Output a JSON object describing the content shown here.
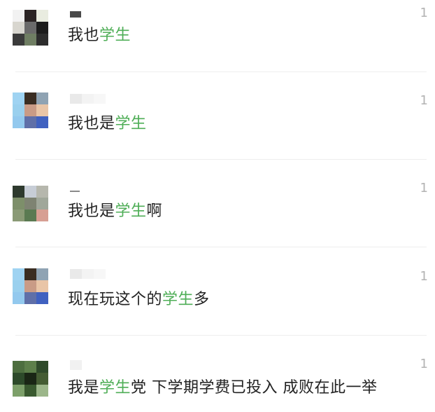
{
  "comments": [
    {
      "avatar_colors": [
        "#f2f2f2",
        "#2b2424",
        "#e9ece0",
        "#d8d6cf",
        "#6a6a6a",
        "#1c1c1c",
        "#3b3b3b",
        "#6f7e63",
        "#2d2d2d"
      ],
      "text_before": "我也",
      "keyword": "学生",
      "text_after": "",
      "likes": "1"
    },
    {
      "avatar_colors": [
        "#9fd3f2",
        "#3a2d22",
        "#8fa3b3",
        "#9ad0ee",
        "#c99b86",
        "#e9c5a7",
        "#93c9ee",
        "#5f6fa8",
        "#4061c0"
      ],
      "text_before": "我也是",
      "keyword": "学生",
      "text_after": "",
      "likes": "1"
    },
    {
      "avatar_colors": [
        "#2e3a2e",
        "#c7cdd6",
        "#b6b7ad",
        "#7d8f6a",
        "#7e8372",
        "#a0a79a",
        "#8a9a76",
        "#5a7a52",
        "#d79f93"
      ],
      "text_before": "我也是",
      "keyword": "学生",
      "text_after": "啊",
      "likes": "1"
    },
    {
      "avatar_colors": [
        "#9fd3f2",
        "#3a2d22",
        "#8fa3b3",
        "#9ad0ee",
        "#c99b86",
        "#e9c5a7",
        "#93c9ee",
        "#5f6fa8",
        "#4061c0"
      ],
      "text_before": "现在玩这个的",
      "keyword": "学生",
      "text_after": "多",
      "likes": "1"
    },
    {
      "avatar_colors": [
        "#4d6e3f",
        "#5d7f4a",
        "#2f4a2a",
        "#2d4a2a",
        "#1a2615",
        "#445c33",
        "#7da06a",
        "#3a5a30",
        "#9cb68a"
      ],
      "text_before": "我是",
      "keyword": "学生",
      "text_after": "党 下学期学费已投入 成败在此一举",
      "likes": "1"
    }
  ],
  "colors": {
    "keyword": "#4fae57",
    "text": "#222222",
    "likes": "#b3b3b3",
    "divider": "#eeeeee"
  }
}
